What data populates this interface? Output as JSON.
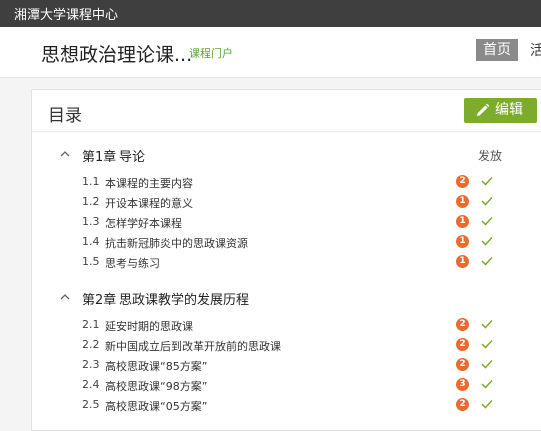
{
  "topbar": {
    "brand": "湘潭大学课程中心"
  },
  "header": {
    "course_title": "思想政治理论课...",
    "portal_link": "课程门户",
    "nav_home": "首页",
    "nav_next": "活"
  },
  "catalog": {
    "title": "目录",
    "edit_label": "编辑",
    "status_header": "发放",
    "colors": {
      "accent": "#7dab2b",
      "badge": "#ec6b2c",
      "check": "#7dab2b"
    },
    "chapters": [
      {
        "number": "第1章",
        "title": "导论",
        "sections": [
          {
            "number": "1.1",
            "title": "本课程的主要内容",
            "count": "2"
          },
          {
            "number": "1.2",
            "title": "开设本课程的意义",
            "count": "1"
          },
          {
            "number": "1.3",
            "title": "怎样学好本课程",
            "count": "1"
          },
          {
            "number": "1.4",
            "title": "抗击新冠肺炎中的思政课资源",
            "count": "1"
          },
          {
            "number": "1.5",
            "title": "思考与练习",
            "count": "1"
          }
        ]
      },
      {
        "number": "第2章",
        "title": "思政课教学的发展历程",
        "sections": [
          {
            "number": "2.1",
            "title": "延安时期的思政课",
            "count": "2"
          },
          {
            "number": "2.2",
            "title": "新中国成立后到改革开放前的思政课",
            "count": "2"
          },
          {
            "number": "2.3",
            "title": "高校思政课“85方案”",
            "count": "2"
          },
          {
            "number": "2.4",
            "title": "高校思政课“98方案”",
            "count": "3"
          },
          {
            "number": "2.5",
            "title": "高校思政课“05方案”",
            "count": "2"
          }
        ]
      }
    ]
  }
}
